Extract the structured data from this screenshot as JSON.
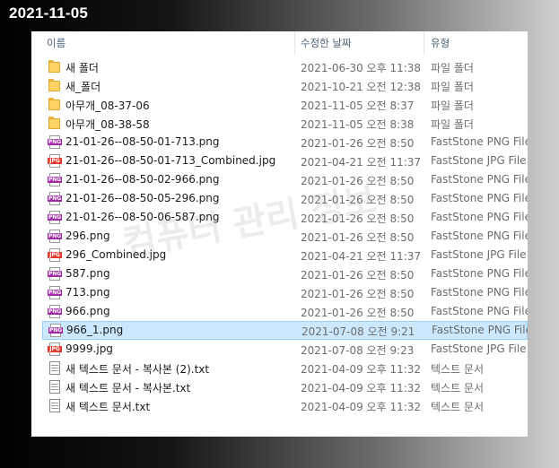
{
  "overlay": {
    "date": "2021-11-05",
    "watermark": "컴퓨터 관리 정보"
  },
  "header": {
    "name": "이름",
    "date_modified": "수정한 날짜",
    "type": "유형",
    "sort_arrow": "^"
  },
  "files": [
    {
      "name": "새 폴더",
      "date": "2021-06-30 오후 11:38",
      "type": "파일 폴더",
      "icon": "folder-icon"
    },
    {
      "name": "새_폴더",
      "date": "2021-10-21 오전 12:38",
      "type": "파일 폴더",
      "icon": "folder-icon"
    },
    {
      "name": "아무개_08-37-06",
      "date": "2021-11-05 오전 8:37",
      "type": "파일 폴더",
      "icon": "folder-icon"
    },
    {
      "name": "아무개_08-38-58",
      "date": "2021-11-05 오전 8:38",
      "type": "파일 폴더",
      "icon": "folder-icon"
    },
    {
      "name": "21-01-26--08-50-01-713.png",
      "date": "2021-01-26 오전 8:50",
      "type": "FastStone PNG File",
      "icon": "png-icon"
    },
    {
      "name": "21-01-26--08-50-01-713_Combined.jpg",
      "date": "2021-04-21 오전 11:37",
      "type": "FastStone JPG File",
      "icon": "jpg-icon"
    },
    {
      "name": "21-01-26--08-50-02-966.png",
      "date": "2021-01-26 오전 8:50",
      "type": "FastStone PNG File",
      "icon": "png-icon"
    },
    {
      "name": "21-01-26--08-50-05-296.png",
      "date": "2021-01-26 오전 8:50",
      "type": "FastStone PNG File",
      "icon": "png-icon"
    },
    {
      "name": "21-01-26--08-50-06-587.png",
      "date": "2021-01-26 오전 8:50",
      "type": "FastStone PNG File",
      "icon": "png-icon"
    },
    {
      "name": "296.png",
      "date": "2021-01-26 오전 8:50",
      "type": "FastStone PNG File",
      "icon": "png-icon"
    },
    {
      "name": "296_Combined.jpg",
      "date": "2021-04-21 오전 11:37",
      "type": "FastStone JPG File",
      "icon": "jpg-icon"
    },
    {
      "name": "587.png",
      "date": "2021-01-26 오전 8:50",
      "type": "FastStone PNG File",
      "icon": "png-icon"
    },
    {
      "name": "713.png",
      "date": "2021-01-26 오전 8:50",
      "type": "FastStone PNG File",
      "icon": "png-icon"
    },
    {
      "name": "966.png",
      "date": "2021-01-26 오전 8:50",
      "type": "FastStone PNG File",
      "icon": "png-icon"
    },
    {
      "name": "966_1.png",
      "date": "2021-07-08 오전 9:21",
      "type": "FastStone PNG File",
      "icon": "png-icon",
      "selected": true
    },
    {
      "name": "9999.jpg",
      "date": "2021-07-08 오전 9:23",
      "type": "FastStone JPG File",
      "icon": "jpg-icon"
    },
    {
      "name": "새 텍스트 문서 - 복사본 (2).txt",
      "date": "2021-04-09 오후 11:32",
      "type": "텍스트 문서",
      "icon": "txt-icon"
    },
    {
      "name": "새 텍스트 문서 - 복사본.txt",
      "date": "2021-04-09 오후 11:32",
      "type": "텍스트 문서",
      "icon": "txt-icon"
    },
    {
      "name": "새 텍스트 문서.txt",
      "date": "2021-04-09 오후 11:32",
      "type": "텍스트 문서",
      "icon": "txt-icon"
    }
  ],
  "icon_labels": {
    "png": "PNG",
    "jpg": "JPG"
  },
  "colors": {
    "selection": "#cce8ff",
    "selection_border": "#99d1ff",
    "png_badge": "#a22aa6",
    "jpg_badge": "#e03a2e",
    "folder": "#ffd366"
  }
}
